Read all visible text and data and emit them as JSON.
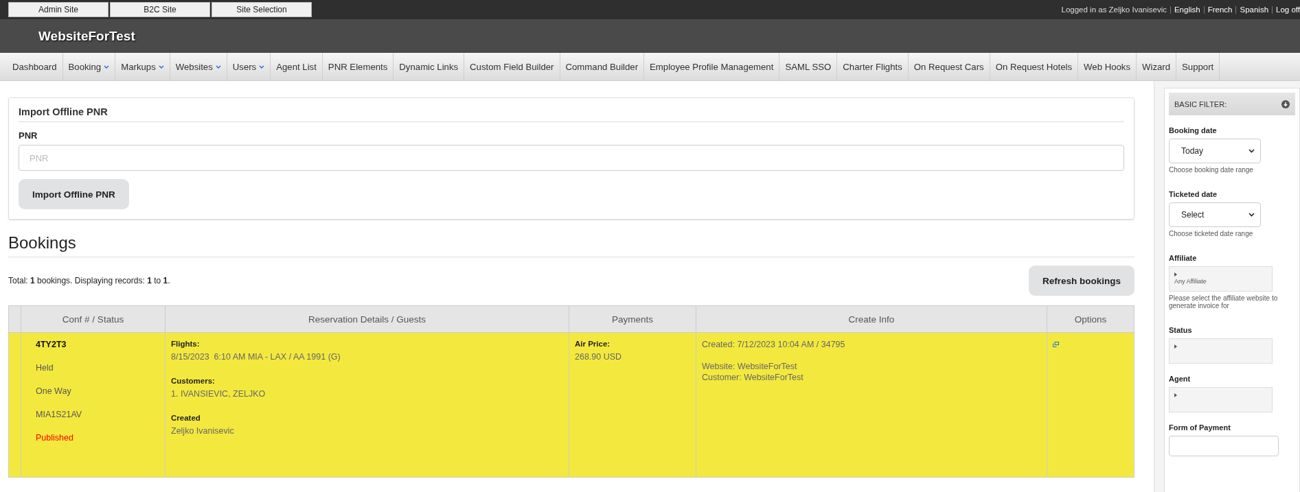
{
  "top_bar": {
    "site_buttons": [
      "Admin Site",
      "B2C Site",
      "Site Selection"
    ],
    "user_text": "Logged in as Zeljko Ivanisevic",
    "languages": [
      "English",
      "French",
      "Spanish",
      "Log off"
    ]
  },
  "header": {
    "title": "WebsiteForTest"
  },
  "nav": [
    {
      "label": "Dashboard",
      "dropdown": false
    },
    {
      "label": "Booking",
      "dropdown": true
    },
    {
      "label": "Markups",
      "dropdown": true
    },
    {
      "label": "Websites",
      "dropdown": true
    },
    {
      "label": "Users",
      "dropdown": true
    },
    {
      "label": "Agent List",
      "dropdown": false
    },
    {
      "label": "PNR Elements",
      "dropdown": false
    },
    {
      "label": "Dynamic Links",
      "dropdown": false
    },
    {
      "label": "Custom Field Builder",
      "dropdown": false
    },
    {
      "label": "Command Builder",
      "dropdown": false
    },
    {
      "label": "Employee Profile Management",
      "dropdown": false
    },
    {
      "label": "SAML SSO",
      "dropdown": false
    },
    {
      "label": "Charter Flights",
      "dropdown": false
    },
    {
      "label": "On Request Cars",
      "dropdown": false
    },
    {
      "label": "On Request Hotels",
      "dropdown": false
    },
    {
      "label": "Web Hooks",
      "dropdown": false
    },
    {
      "label": "Wizard",
      "dropdown": false
    },
    {
      "label": "Support",
      "dropdown": false
    }
  ],
  "import_card": {
    "title": "Import Offline PNR",
    "field_label": "PNR",
    "placeholder": "PNR",
    "button": "Import Offline PNR"
  },
  "bookings": {
    "title": "Bookings",
    "summary": "Total: **1** bookings. Displaying records: **1** to **1**.",
    "refresh_button": "Refresh bookings",
    "columns": [
      "Conf # / Status",
      "Reservation Details / Guests",
      "Payments",
      "Create Info",
      "Options"
    ],
    "rows": [
      {
        "highlighted": true,
        "status_lines": [
          {
            "kind": "code",
            "text": "4TY2T3"
          },
          {
            "kind": "text",
            "text": "Held"
          },
          {
            "kind": "text",
            "text": "One Way"
          },
          {
            "kind": "text",
            "text": "MIA1S21AV"
          },
          {
            "kind": "alert",
            "text": "Published"
          }
        ],
        "details": [
          {
            "label": "Flights:",
            "lines": [
              "8/15/2023  6:10 AM MIA - LAX / AA 1991 (G)"
            ]
          },
          {
            "label": "Customers:",
            "lines": [
              "1. IVANSIEVIC, ZELJKO"
            ]
          },
          {
            "label": "Created",
            "lines": [
              "Zeljko Ivanisevic"
            ]
          }
        ],
        "payments": {
          "label": "Air Price:",
          "value": "268.90 USD"
        },
        "create_info": [
          "Created: 7/12/2023 10:04 AM / 34795",
          "Website: WebsiteForTest",
          "Customer: WebsiteForTest"
        ]
      }
    ]
  },
  "filter": {
    "title": "BASIC FILTER:",
    "fields": [
      {
        "kind": "select",
        "label": "Booking date",
        "value": "Today",
        "hint": "Choose booking date range"
      },
      {
        "kind": "select",
        "label": "Ticketed date",
        "value": "Select",
        "hint": "Choose ticketed date range"
      },
      {
        "kind": "tree",
        "label": "Affiliate",
        "value": "Any Affiliate",
        "hint": "Please select the affiliate website to generate invoice for"
      },
      {
        "kind": "tree",
        "label": "Status"
      },
      {
        "kind": "tree",
        "label": "Agent"
      },
      {
        "kind": "input",
        "label": "Form of Payment"
      }
    ]
  }
}
